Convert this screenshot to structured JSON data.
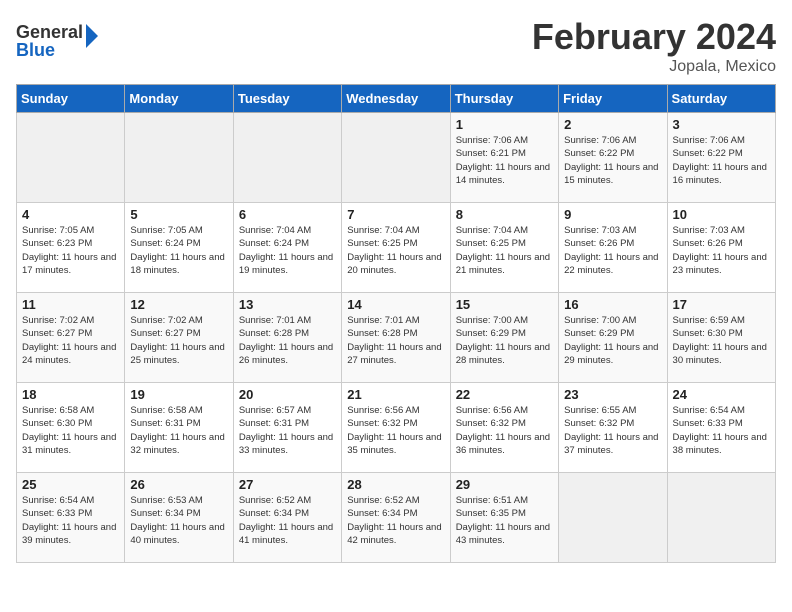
{
  "header": {
    "logo_general": "General",
    "logo_blue": "Blue",
    "main_title": "February 2024",
    "subtitle": "Jopala, Mexico"
  },
  "days_of_week": [
    "Sunday",
    "Monday",
    "Tuesday",
    "Wednesday",
    "Thursday",
    "Friday",
    "Saturday"
  ],
  "weeks": [
    [
      {
        "day": "",
        "info": ""
      },
      {
        "day": "",
        "info": ""
      },
      {
        "day": "",
        "info": ""
      },
      {
        "day": "",
        "info": ""
      },
      {
        "day": "1",
        "info": "Sunrise: 7:06 AM\nSunset: 6:21 PM\nDaylight: 11 hours\nand 14 minutes."
      },
      {
        "day": "2",
        "info": "Sunrise: 7:06 AM\nSunset: 6:22 PM\nDaylight: 11 hours\nand 15 minutes."
      },
      {
        "day": "3",
        "info": "Sunrise: 7:06 AM\nSunset: 6:22 PM\nDaylight: 11 hours\nand 16 minutes."
      }
    ],
    [
      {
        "day": "4",
        "info": "Sunrise: 7:05 AM\nSunset: 6:23 PM\nDaylight: 11 hours\nand 17 minutes."
      },
      {
        "day": "5",
        "info": "Sunrise: 7:05 AM\nSunset: 6:24 PM\nDaylight: 11 hours\nand 18 minutes."
      },
      {
        "day": "6",
        "info": "Sunrise: 7:04 AM\nSunset: 6:24 PM\nDaylight: 11 hours\nand 19 minutes."
      },
      {
        "day": "7",
        "info": "Sunrise: 7:04 AM\nSunset: 6:25 PM\nDaylight: 11 hours\nand 20 minutes."
      },
      {
        "day": "8",
        "info": "Sunrise: 7:04 AM\nSunset: 6:25 PM\nDaylight: 11 hours\nand 21 minutes."
      },
      {
        "day": "9",
        "info": "Sunrise: 7:03 AM\nSunset: 6:26 PM\nDaylight: 11 hours\nand 22 minutes."
      },
      {
        "day": "10",
        "info": "Sunrise: 7:03 AM\nSunset: 6:26 PM\nDaylight: 11 hours\nand 23 minutes."
      }
    ],
    [
      {
        "day": "11",
        "info": "Sunrise: 7:02 AM\nSunset: 6:27 PM\nDaylight: 11 hours\nand 24 minutes."
      },
      {
        "day": "12",
        "info": "Sunrise: 7:02 AM\nSunset: 6:27 PM\nDaylight: 11 hours\nand 25 minutes."
      },
      {
        "day": "13",
        "info": "Sunrise: 7:01 AM\nSunset: 6:28 PM\nDaylight: 11 hours\nand 26 minutes."
      },
      {
        "day": "14",
        "info": "Sunrise: 7:01 AM\nSunset: 6:28 PM\nDaylight: 11 hours\nand 27 minutes."
      },
      {
        "day": "15",
        "info": "Sunrise: 7:00 AM\nSunset: 6:29 PM\nDaylight: 11 hours\nand 28 minutes."
      },
      {
        "day": "16",
        "info": "Sunrise: 7:00 AM\nSunset: 6:29 PM\nDaylight: 11 hours\nand 29 minutes."
      },
      {
        "day": "17",
        "info": "Sunrise: 6:59 AM\nSunset: 6:30 PM\nDaylight: 11 hours\nand 30 minutes."
      }
    ],
    [
      {
        "day": "18",
        "info": "Sunrise: 6:58 AM\nSunset: 6:30 PM\nDaylight: 11 hours\nand 31 minutes."
      },
      {
        "day": "19",
        "info": "Sunrise: 6:58 AM\nSunset: 6:31 PM\nDaylight: 11 hours\nand 32 minutes."
      },
      {
        "day": "20",
        "info": "Sunrise: 6:57 AM\nSunset: 6:31 PM\nDaylight: 11 hours\nand 33 minutes."
      },
      {
        "day": "21",
        "info": "Sunrise: 6:56 AM\nSunset: 6:32 PM\nDaylight: 11 hours\nand 35 minutes."
      },
      {
        "day": "22",
        "info": "Sunrise: 6:56 AM\nSunset: 6:32 PM\nDaylight: 11 hours\nand 36 minutes."
      },
      {
        "day": "23",
        "info": "Sunrise: 6:55 AM\nSunset: 6:32 PM\nDaylight: 11 hours\nand 37 minutes."
      },
      {
        "day": "24",
        "info": "Sunrise: 6:54 AM\nSunset: 6:33 PM\nDaylight: 11 hours\nand 38 minutes."
      }
    ],
    [
      {
        "day": "25",
        "info": "Sunrise: 6:54 AM\nSunset: 6:33 PM\nDaylight: 11 hours\nand 39 minutes."
      },
      {
        "day": "26",
        "info": "Sunrise: 6:53 AM\nSunset: 6:34 PM\nDaylight: 11 hours\nand 40 minutes."
      },
      {
        "day": "27",
        "info": "Sunrise: 6:52 AM\nSunset: 6:34 PM\nDaylight: 11 hours\nand 41 minutes."
      },
      {
        "day": "28",
        "info": "Sunrise: 6:52 AM\nSunset: 6:34 PM\nDaylight: 11 hours\nand 42 minutes."
      },
      {
        "day": "29",
        "info": "Sunrise: 6:51 AM\nSunset: 6:35 PM\nDaylight: 11 hours\nand 43 minutes."
      },
      {
        "day": "",
        "info": ""
      },
      {
        "day": "",
        "info": ""
      }
    ]
  ]
}
